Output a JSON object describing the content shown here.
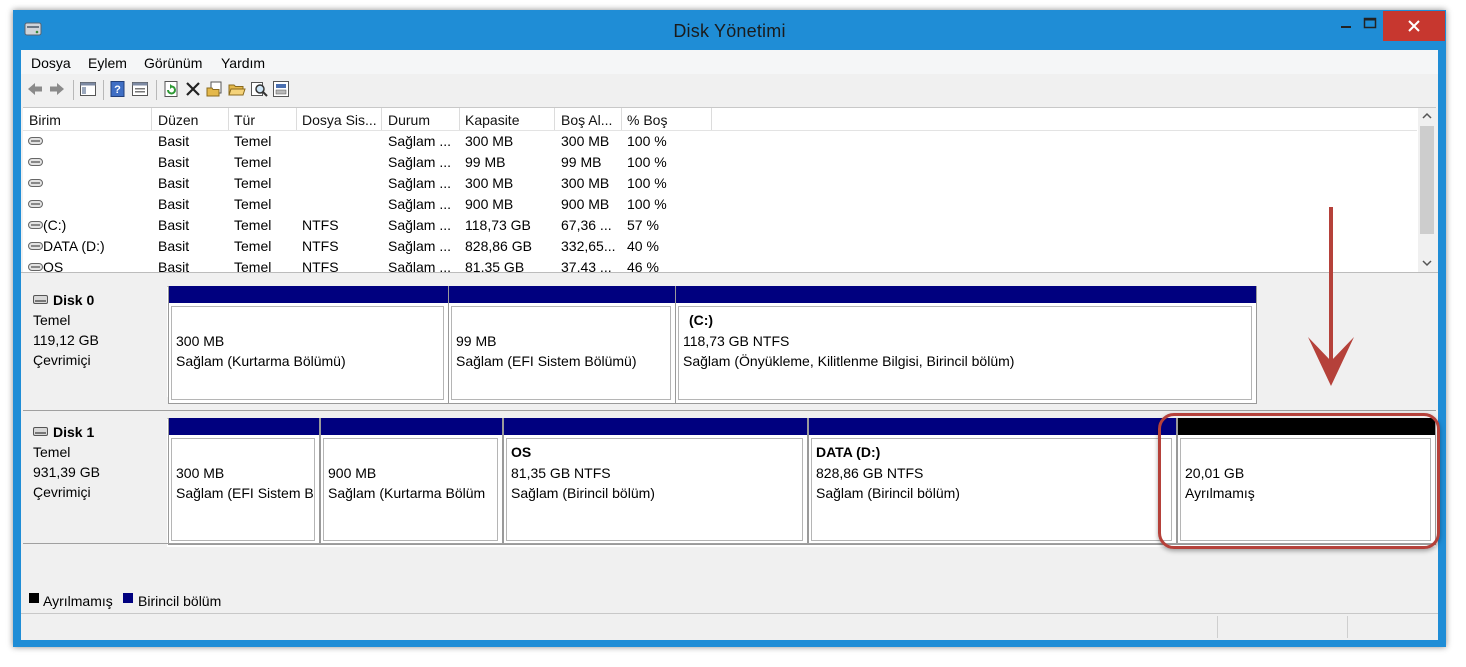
{
  "window": {
    "title": "Disk Yönetimi"
  },
  "menu": [
    "Dosya",
    "Eylem",
    "Görünüm",
    "Yardım"
  ],
  "toolbar": {
    "icons": [
      "back-arrow-icon",
      "forward-arrow-icon",
      "console-tree-icon",
      "help-icon",
      "properties-icon",
      "refresh-icon",
      "delete-icon",
      "folder-properties-icon",
      "open-folder-icon",
      "search-icon",
      "rescan-disk-icon"
    ]
  },
  "volumes": {
    "columns": [
      "Birim",
      "Düzen",
      "Tür",
      "Dosya Sis...",
      "Durum",
      "Kapasite",
      "Boş Al...",
      "% Boş"
    ],
    "rows": [
      [
        "",
        "Basit",
        "Temel",
        "",
        "Sağlam ...",
        "300 MB",
        "300 MB",
        "100 %"
      ],
      [
        "",
        "Basit",
        "Temel",
        "",
        "Sağlam ...",
        "99 MB",
        "99 MB",
        "100 %"
      ],
      [
        "",
        "Basit",
        "Temel",
        "",
        "Sağlam ...",
        "300 MB",
        "300 MB",
        "100 %"
      ],
      [
        "",
        "Basit",
        "Temel",
        "",
        "Sağlam ...",
        "900 MB",
        "900 MB",
        "100 %"
      ],
      [
        "(C:)",
        "Basit",
        "Temel",
        "NTFS",
        "Sağlam ...",
        "118,73 GB",
        "67,36 ...",
        "57 %"
      ],
      [
        "DATA (D:)",
        "Basit",
        "Temel",
        "NTFS",
        "Sağlam ...",
        "828,86 GB",
        "332,65...",
        "40 %"
      ],
      [
        "OS",
        "Basit",
        "Temel",
        "NTFS",
        "Sağlam ...",
        "81,35 GB",
        "37,43 ...",
        "46 %"
      ]
    ]
  },
  "disks": [
    {
      "name": "Disk 0",
      "type": "Temel",
      "size": "119,12 GB",
      "status": "Çevrimiçi",
      "partitions": [
        {
          "name": "",
          "size": "300 MB",
          "status": "Sağlam (Kurtarma Bölümü)",
          "kind": "primary"
        },
        {
          "name": "",
          "size": "99 MB",
          "status": "Sağlam (EFI Sistem Bölümü)",
          "kind": "primary"
        },
        {
          "name": "(C:)",
          "size": "118,73 GB NTFS",
          "status": "Sağlam (Önyükleme, Kilitlenme Bilgisi, Birincil bölüm)",
          "kind": "primary"
        }
      ]
    },
    {
      "name": "Disk 1",
      "type": "Temel",
      "size": "931,39 GB",
      "status": "Çevrimiçi",
      "partitions": [
        {
          "name": "",
          "size": "300 MB",
          "status": "Sağlam (EFI Sistem B",
          "kind": "primary"
        },
        {
          "name": "",
          "size": "900 MB",
          "status": "Sağlam (Kurtarma Bölüm",
          "kind": "primary"
        },
        {
          "name": "OS",
          "size": "81,35 GB NTFS",
          "status": "Sağlam (Birincil bölüm)",
          "kind": "primary"
        },
        {
          "name": "DATA  (D:)",
          "size": "828,86 GB NTFS",
          "status": "Sağlam (Birincil bölüm)",
          "kind": "primary"
        },
        {
          "name": "",
          "size": "20,01 GB",
          "status": "Ayrılmamış",
          "kind": "unallocated"
        }
      ]
    }
  ],
  "legend": [
    {
      "label": "Ayrılmamış",
      "color": "#000000"
    },
    {
      "label": "Birincil bölüm",
      "color": "#00007f"
    }
  ],
  "colors": {
    "titlebar": "#1f8dd6",
    "close_button": "#c7372f",
    "primary_partition": "#00007f",
    "unallocated": "#000000",
    "annotation": "#b5413a"
  }
}
